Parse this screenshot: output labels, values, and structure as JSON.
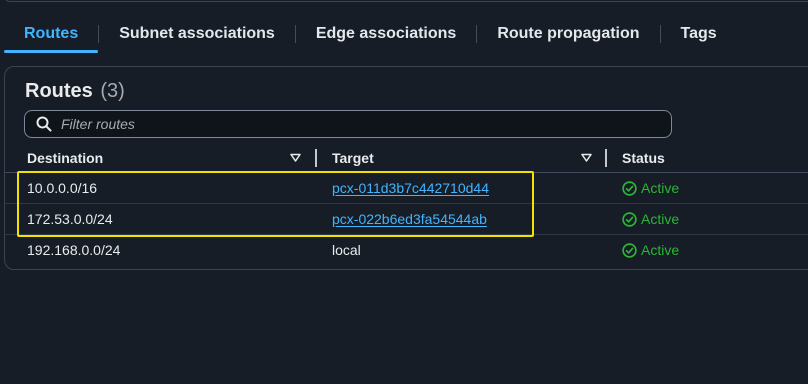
{
  "tabs": [
    {
      "label": "Routes",
      "active": true
    },
    {
      "label": "Subnet associations",
      "active": false
    },
    {
      "label": "Edge associations",
      "active": false
    },
    {
      "label": "Route propagation",
      "active": false
    },
    {
      "label": "Tags",
      "active": false
    }
  ],
  "routes_panel": {
    "title": "Routes",
    "count": "(3)",
    "search_placeholder": "Filter routes",
    "columns": [
      "Destination",
      "Target",
      "Status"
    ],
    "rows": [
      {
        "destination": "10.0.0.0/16",
        "target": "pcx-011d3b7c442710d44",
        "target_is_link": true,
        "status": "Active"
      },
      {
        "destination": "172.53.0.0/24",
        "target": "pcx-022b6ed3fa54544ab",
        "target_is_link": true,
        "status": "Active"
      },
      {
        "destination": "192.168.0.0/24",
        "target": "local",
        "target_is_link": false,
        "status": "Active"
      }
    ]
  },
  "colors": {
    "accent": "#42b4ff",
    "status_active": "#2bb534",
    "highlight": "#f2e200",
    "background": "#161d26"
  },
  "icons": [
    "search-icon",
    "sort-caret-icon",
    "check-circle-icon"
  ]
}
